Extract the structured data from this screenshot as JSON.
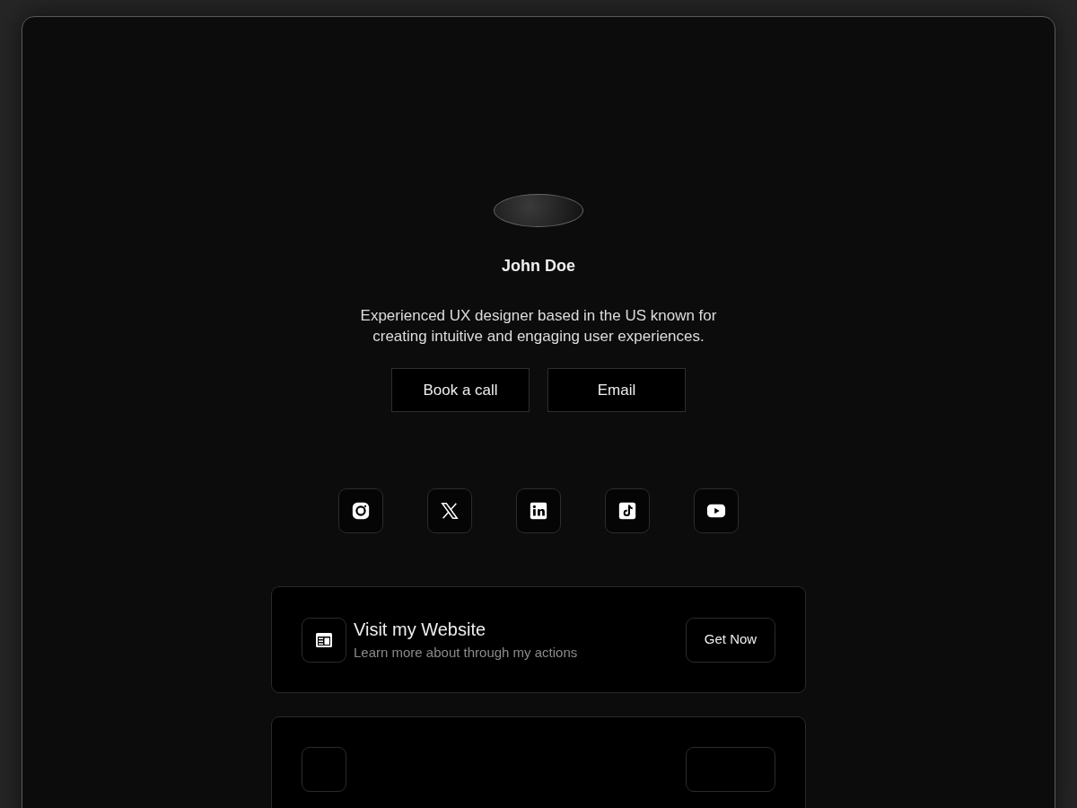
{
  "profile": {
    "name": "John Doe",
    "bio": "Experienced UX designer based in the US known for creating intuitive and engaging user experiences."
  },
  "buttons": [
    "Book a call",
    "Email"
  ],
  "socials": [
    {
      "kind": "instagram"
    },
    {
      "kind": "x"
    },
    {
      "kind": "linkedin"
    },
    {
      "kind": "tiktok"
    },
    {
      "kind": "youtube"
    }
  ],
  "link_cards": [
    {
      "title": "Visit my Website",
      "subtitle": "Learn more about through my actions",
      "action": "Get Now"
    }
  ]
}
